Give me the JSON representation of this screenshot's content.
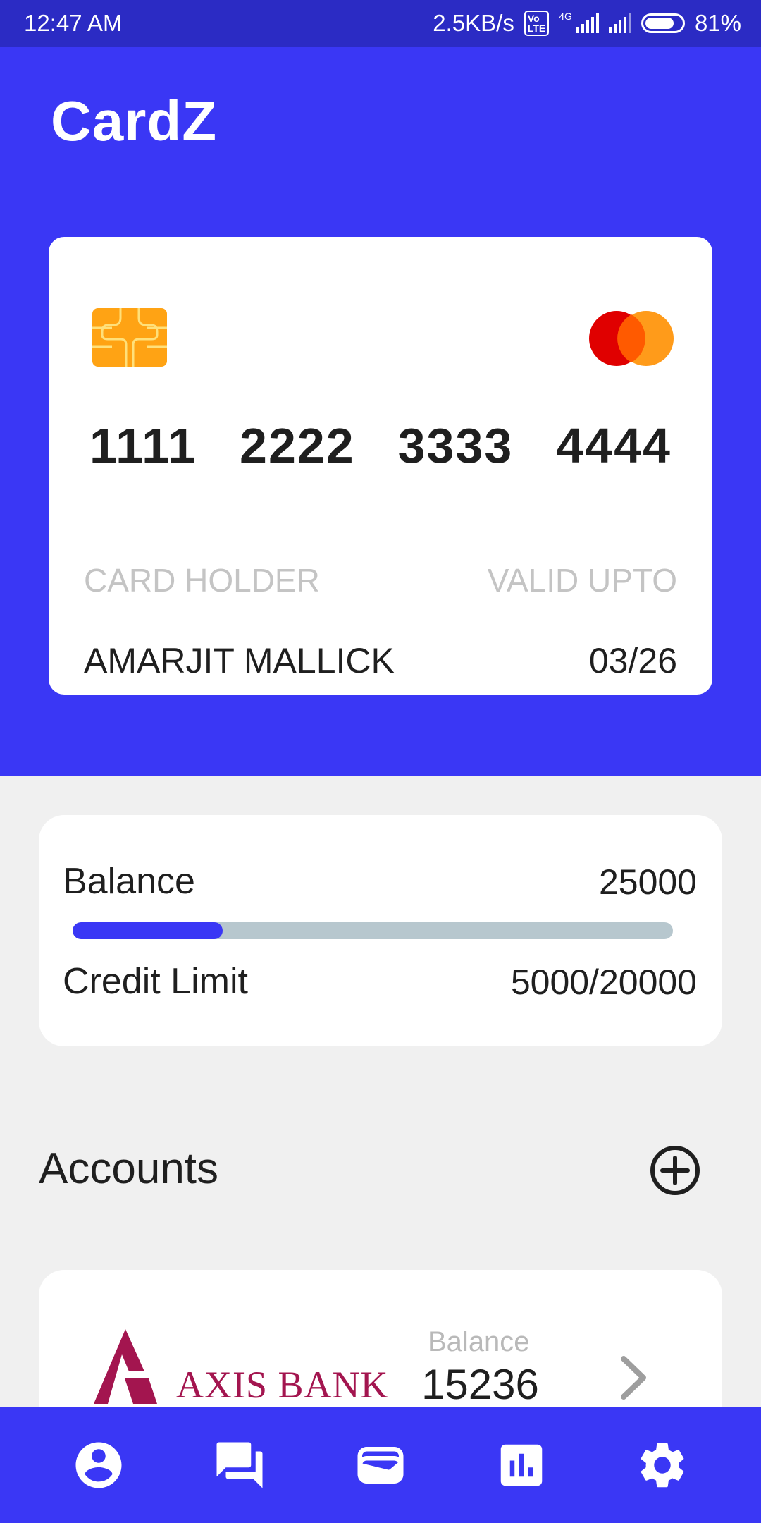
{
  "status_bar": {
    "time": "12:47 AM",
    "net_speed": "2.5KB/s",
    "volte": "Vo LTE",
    "network": "4G",
    "battery": "81%"
  },
  "app": {
    "title": "CardZ"
  },
  "card": {
    "number_groups": [
      "1111",
      "2222",
      "3333",
      "4444"
    ],
    "holder_label": "CARD HOLDER",
    "valid_label": "VALID UPTO",
    "holder_name": "AMARJIT MALLICK",
    "expiry": "03/26",
    "brand_icon": "mastercard-icon",
    "chip_icon": "chip-icon"
  },
  "balance": {
    "label": "Balance",
    "value": "25000",
    "credit_label": "Credit Limit",
    "credit_value": "5000/20000",
    "progress_fraction": 0.25
  },
  "accounts": {
    "heading": "Accounts",
    "add_icon": "add-circle-icon",
    "items": [
      {
        "bank": "AXIS BANK",
        "balance_label": "Balance",
        "balance": "15236"
      }
    ]
  },
  "nav": {
    "items": [
      "profile-icon",
      "chat-icon",
      "wallet-icon",
      "stats-icon",
      "settings-icon"
    ]
  },
  "colors": {
    "primary": "#3a37f5",
    "status_bar": "#2b2bc4",
    "chip": "#ffa314",
    "bank_brand": "#a3154f",
    "progress_track": "#b7c7ce"
  }
}
